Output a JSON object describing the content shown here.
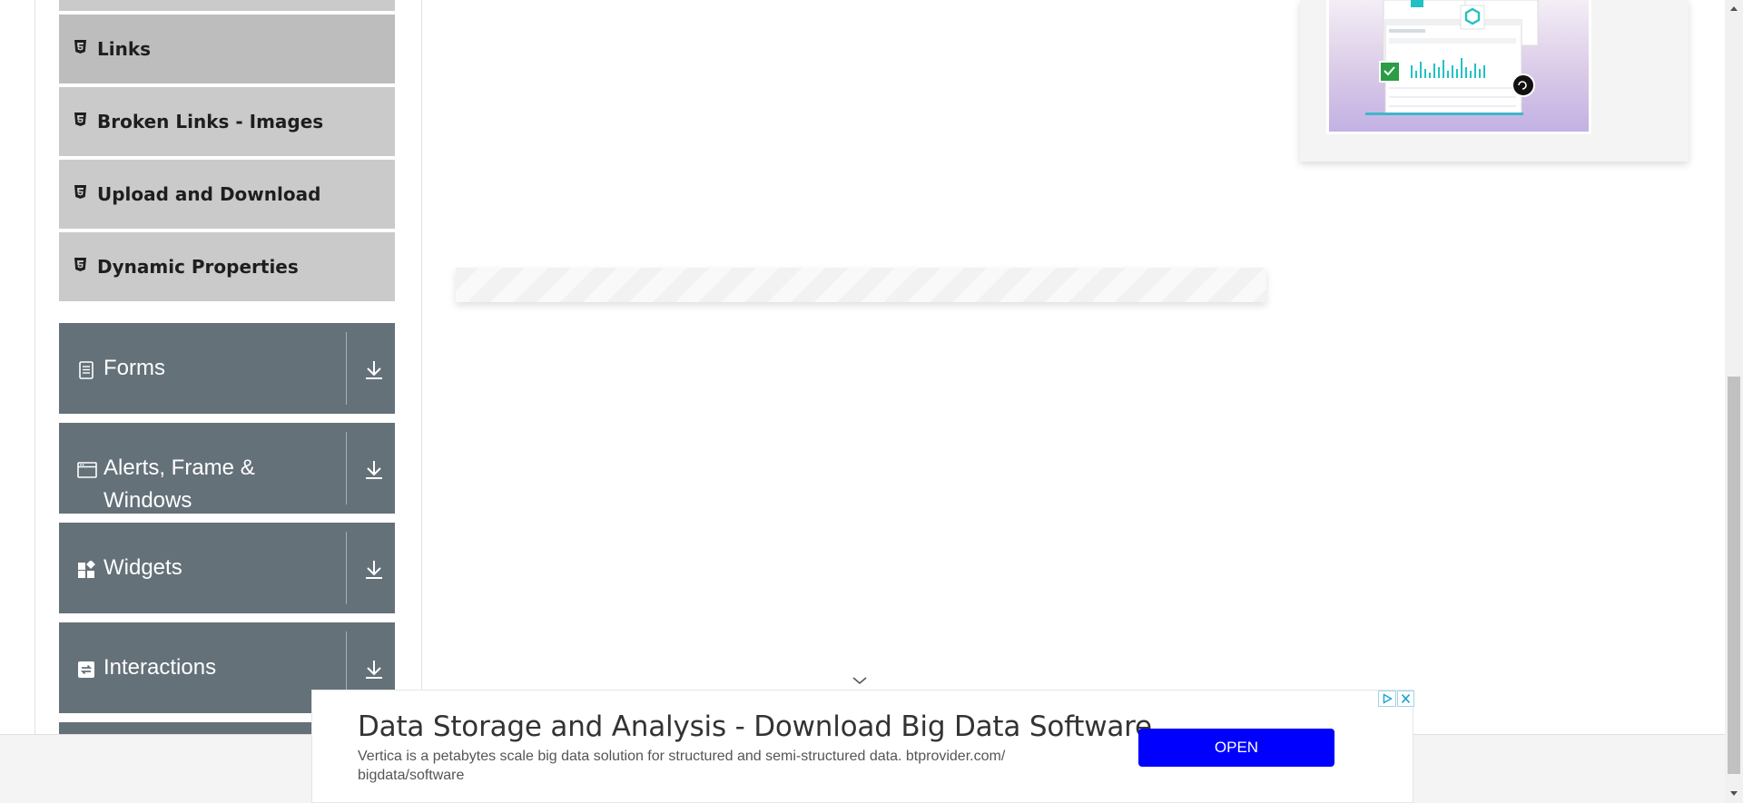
{
  "sidebar": {
    "subitems": [
      {
        "label": "Links",
        "icon": "html5-icon"
      },
      {
        "label": "Broken Links - Images",
        "icon": "html5-icon"
      },
      {
        "label": "Upload and Download",
        "icon": "html5-icon"
      },
      {
        "label": "Dynamic Properties",
        "icon": "html5-icon"
      }
    ],
    "groups": [
      {
        "label": "Forms",
        "icon": "document-icon"
      },
      {
        "label": "Alerts, Frame & Windows",
        "icon": "window-icon"
      },
      {
        "label": "Widgets",
        "icon": "widgets-icon"
      },
      {
        "label": "Interactions",
        "icon": "interactions-icon"
      }
    ]
  },
  "ad_banner": {
    "title": "Data Storage and Analysis - Download Big Data Software",
    "description": "Vertica is a petabytes scale big data solution for structured and semi-structured data. btprovider.com/ bigdata/software",
    "open_label": "OPEN"
  },
  "colors": {
    "group_bg": "#647179",
    "subitem_bg": "#cacaca",
    "open_button": "#0000ff"
  }
}
